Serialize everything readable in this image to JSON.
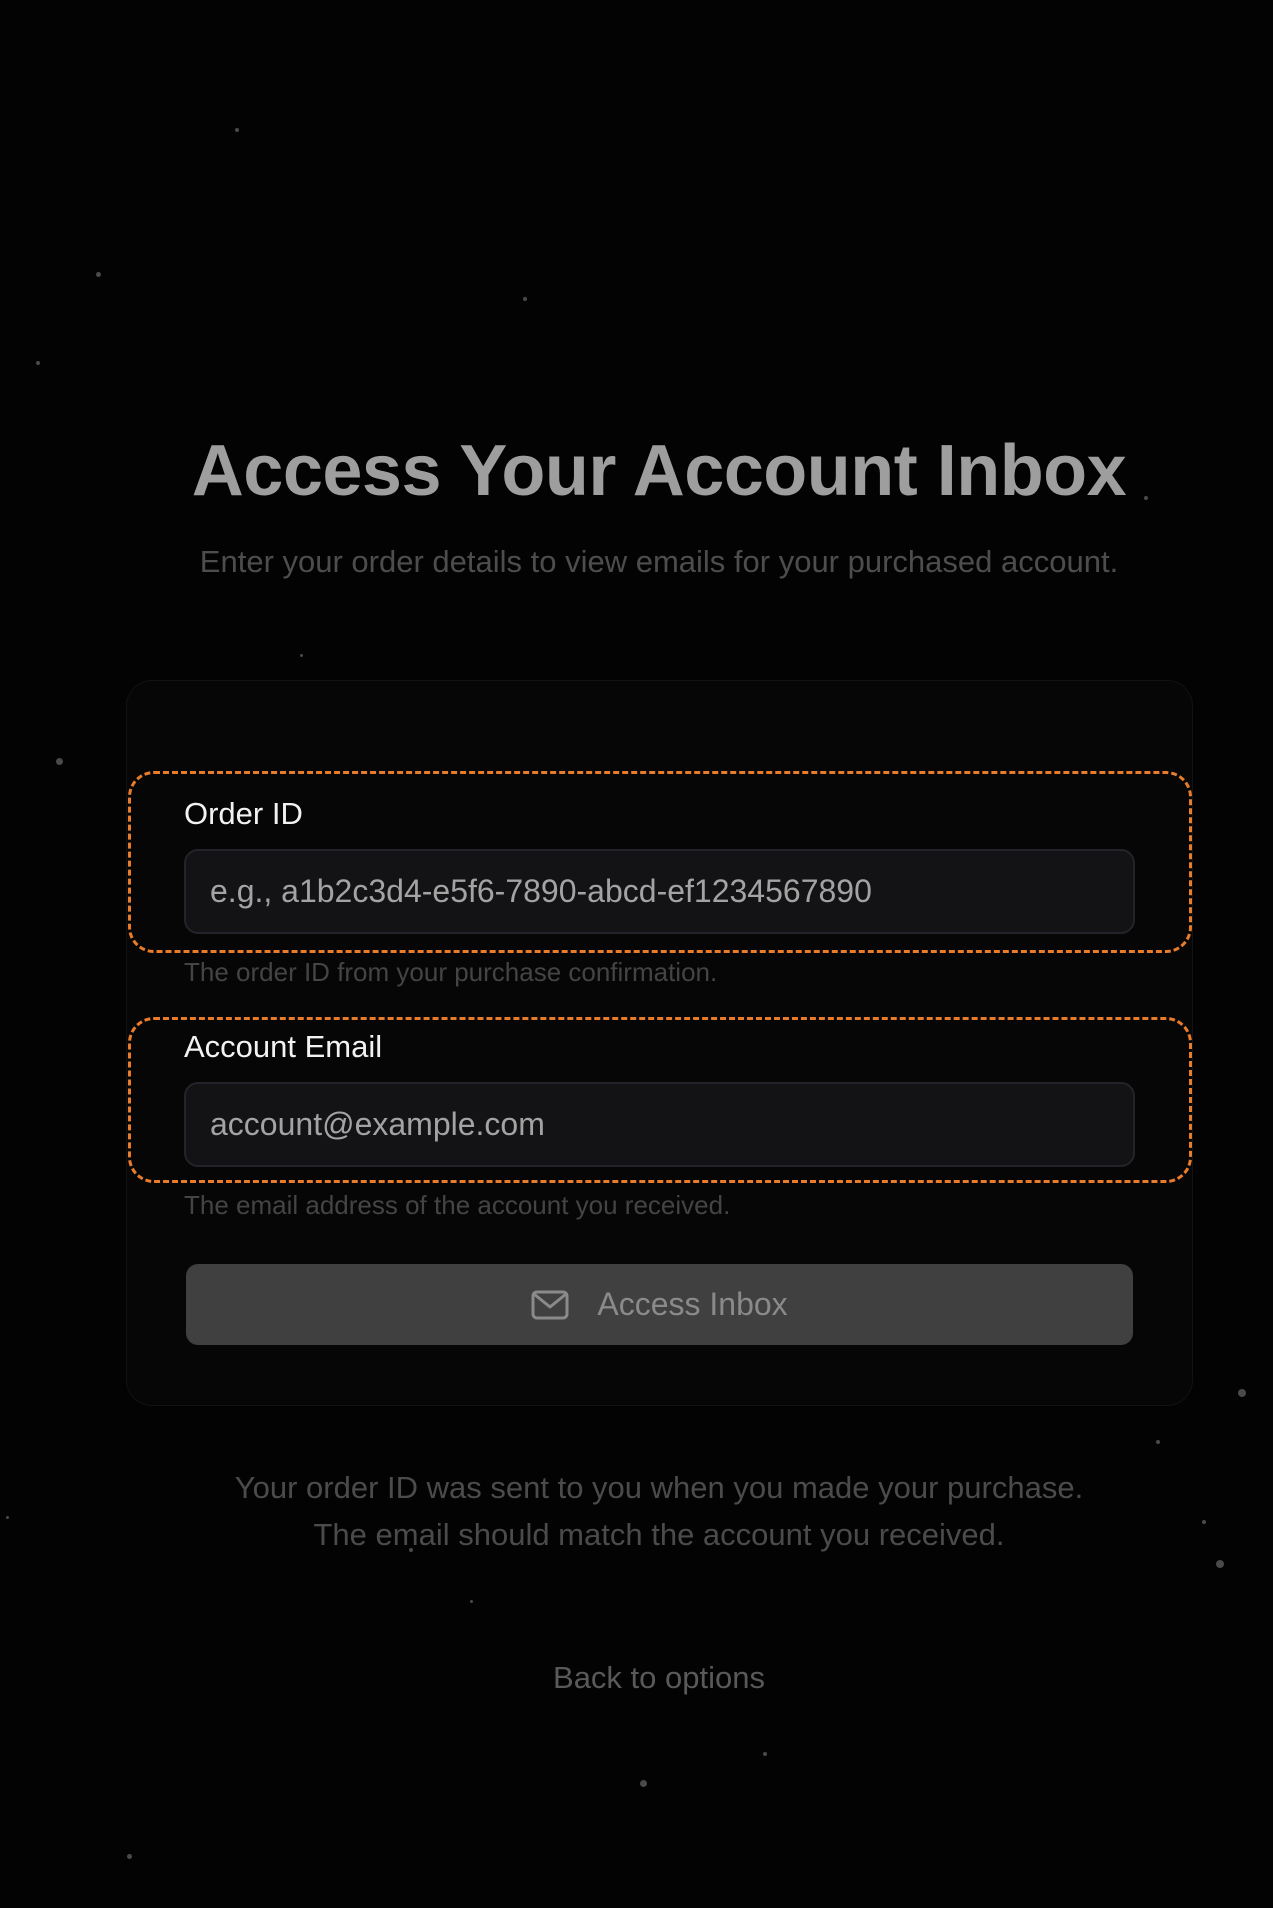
{
  "header": {
    "title": "Access Your Account Inbox",
    "subtitle": "Enter your order details to view emails for your purchased account."
  },
  "form": {
    "order_id": {
      "label": "Order ID",
      "placeholder": "e.g., a1b2c3d4-e5f6-7890-abcd-ef1234567890",
      "value": "",
      "helper": "The order ID from your purchase confirmation."
    },
    "email": {
      "label": "Account Email",
      "placeholder": "account@example.com",
      "value": "",
      "helper": "The email address of the account you received."
    },
    "submit": {
      "label": "Access Inbox",
      "icon": "mail-icon"
    }
  },
  "footer": {
    "note_line_1": "Your order ID was sent to you when you made your purchase.",
    "note_line_2": "The email should match the account you received.",
    "back_link": "Back to options"
  },
  "colors": {
    "background": "#030303",
    "highlight": "#e87c2b",
    "button": "#404040"
  }
}
